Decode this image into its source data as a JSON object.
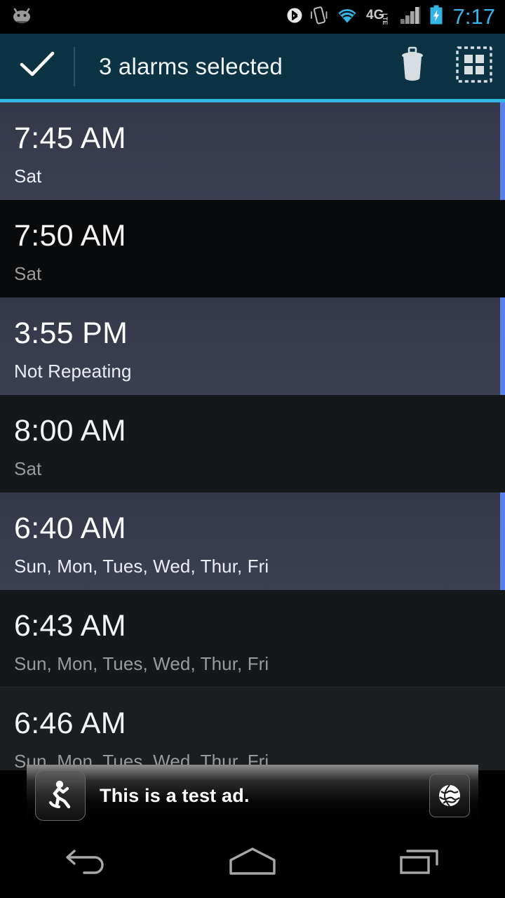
{
  "status_bar": {
    "left_icon": "android-mascot-icon",
    "icons": [
      "bluetooth-icon",
      "vibrate-icon",
      "wifi-icon",
      "4g-lte-icon",
      "signal-bars-icon",
      "battery-charging-icon"
    ],
    "network_label": "4G",
    "network_sub": "LTE",
    "clock": "7:17",
    "clock_color": "#39b4e8"
  },
  "action_bar": {
    "done_icon": "check-icon",
    "title": "3 alarms selected",
    "delete_icon": "trash-icon",
    "select_all_icon": "select-all-icon",
    "background": "#0c3344",
    "accent": "#33b5e5"
  },
  "alarms": [
    {
      "time": "7:45 AM",
      "days": "Sat",
      "selected": true
    },
    {
      "time": "7:50 AM",
      "days": "Sat",
      "selected": false
    },
    {
      "time": "3:55 PM",
      "days": "Not Repeating",
      "selected": true
    },
    {
      "time": "8:00 AM",
      "days": "Sat",
      "selected": false
    },
    {
      "time": "6:40 AM",
      "days": "Sun, Mon, Tues, Wed, Thur, Fri",
      "selected": true
    },
    {
      "time": "6:43 AM",
      "days": "Sun, Mon, Tues, Wed, Thur, Fri",
      "selected": false
    },
    {
      "time": "6:46 AM",
      "days": "Sun, Mon, Tues, Wed, Thur, Fri",
      "selected": false
    }
  ],
  "selected_count": 3,
  "ad": {
    "text": "This is a test ad.",
    "left_icon": "running-person-icon",
    "right_icon": "globe-icon"
  },
  "nav_bar": {
    "back": "back-icon",
    "home": "home-icon",
    "recents": "recents-icon"
  },
  "colors": {
    "selected_row": "#3b3f50",
    "unselected_row": "#0d0f11",
    "selection_stripe": "#5b7fe8",
    "accent_cyan": "#33b5e5"
  }
}
